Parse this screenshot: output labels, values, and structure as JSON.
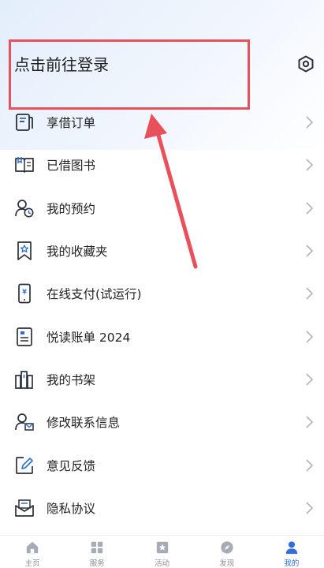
{
  "header": {
    "login_text": "点击前往登录"
  },
  "menu": {
    "items": [
      {
        "label": "享借订单",
        "icon": "order-list-icon"
      },
      {
        "label": "已借图书",
        "icon": "open-book-icon"
      },
      {
        "label": "我的预约",
        "icon": "user-clock-icon"
      },
      {
        "label": "我的收藏夹",
        "icon": "bookmark-star-icon"
      },
      {
        "label": "在线支付(试运行)",
        "icon": "phone-yuan-icon"
      },
      {
        "label": "悦读账单 2024",
        "icon": "bill-icon"
      },
      {
        "label": "我的书架",
        "icon": "bookshelf-icon"
      },
      {
        "label": "修改联系信息",
        "icon": "user-mail-icon"
      },
      {
        "label": "意见反馈",
        "icon": "edit-pencil-icon"
      },
      {
        "label": "隐私协议",
        "icon": "privacy-envelope-icon"
      }
    ]
  },
  "tabbar": {
    "tabs": [
      {
        "label": "主页",
        "icon": "home-icon"
      },
      {
        "label": "服务",
        "icon": "grid-icon"
      },
      {
        "label": "活动",
        "icon": "star-frame-icon"
      },
      {
        "label": "发现",
        "icon": "compass-icon"
      },
      {
        "label": "我的",
        "icon": "person-icon"
      }
    ],
    "active_index": 4
  },
  "colors": {
    "accent": "#2f6fd6",
    "highlight_red": "#e8505b",
    "icon_dark": "#2b2f3a",
    "icon_blue": "#2f6fd6"
  }
}
